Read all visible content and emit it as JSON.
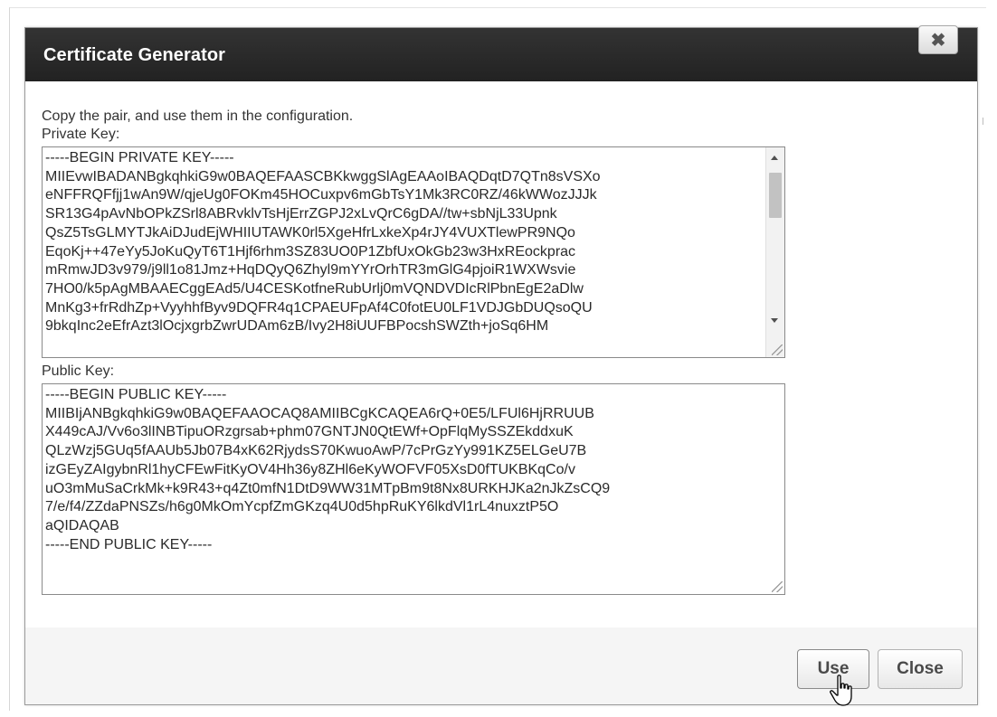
{
  "dialog": {
    "title": "Certificate Generator",
    "close_icon": "close-x-icon",
    "close_glyph": "✖",
    "instruction": "Copy the pair, and use them in the configuration.",
    "private_key": {
      "label": "Private Key:",
      "text": "-----BEGIN PRIVATE KEY-----\nMIIEvwIBADANBgkqhkiG9w0BAQEFAASCBKkwggSlAgEAAoIBAQDqtD7QTn8sVSXo\neNFFRQFfjj1wAn9W/qjeUg0FOKm45HOCuxpv6mGbTsY1Mk3RC0RZ/46kWWozJJJk\nSR13G4pAvNbOPkZSrl8ABRvklvTsHjErrZGPJ2xLvQrC6gDA//tw+sbNjL33Upnk\nQsZ5TsGLMYTJkAiDJudEjWHIIUTAWK0rl5XgeHfrLxkeXp4rJY4VUXTlewPR9NQo\nEqoKj++47eYy5JoKuQyT6T1Hjf6rhm3SZ83UO0P1ZbfUxOkGb23w3HxREockprac\nmRmwJD3v979/j9ll1o81Jmz+HqDQyQ6Zhyl9mYYrOrhTR3mGlG4pjoiR1WXWsvie\n7HO0/k5pAgMBAAECggEAd5/U4CESKotfneRubUrlj0mVQNDVDIcRlPbnEgE2aDlw\nMnKg3+frRdhZp+VyyhhfByv9DQFR4q1CPAEUFpAf4C0fotEU0LF1VDJGbDUQsoQU\n9bkqInc2eEfrAzt3lOcjxgrbZwrUDAm6zB/Ivy2H8iUUFBPocshSWZth+joSq6HM"
    },
    "public_key": {
      "label": "Public Key:",
      "text": "-----BEGIN PUBLIC KEY-----\nMIIBIjANBgkqhkiG9w0BAQEFAAOCAQ8AMIIBCgKCAQEA6rQ+0E5/LFUl6HjRRUUB\nX449cAJ/Vv6o3lINBTipuORzgrsab+phm07GNTJN0QtEWf+OpFlqMySSZEkddxuK\nQLzWzj5GUq5fAAUb5Jb07B4xK62RjydsS70KwuoAwP/7cPrGzYy991KZ5ELGeU7B\nizGEyZAIgybnRl1hyCFEwFitKyOV4Hh36y8ZHl6eKyWOFVF05XsD0fTUKBKqCo/v\nuO3mMuSaCrkMk+k9R43+q4Zt0mfN1DtD9WW31MTpBm9t8Nx8URKHJKa2nJkZsCQ9\n7/e/f4/ZZdaPNSZs/h6g0MkOmYcpfZmGKzq4U0d5hpRuKY6lkdVl1rL4nuxztP5O\naQIDAQAB\n-----END PUBLIC KEY-----"
    },
    "buttons": {
      "use": "Use",
      "close": "Close"
    },
    "scroll_up_icon": "scroll-up-arrow-icon",
    "scroll_down_icon": "scroll-down-arrow-icon",
    "resize_icon": "resize-grip-icon",
    "cursor_icon": "hand-pointer-cursor-icon"
  }
}
